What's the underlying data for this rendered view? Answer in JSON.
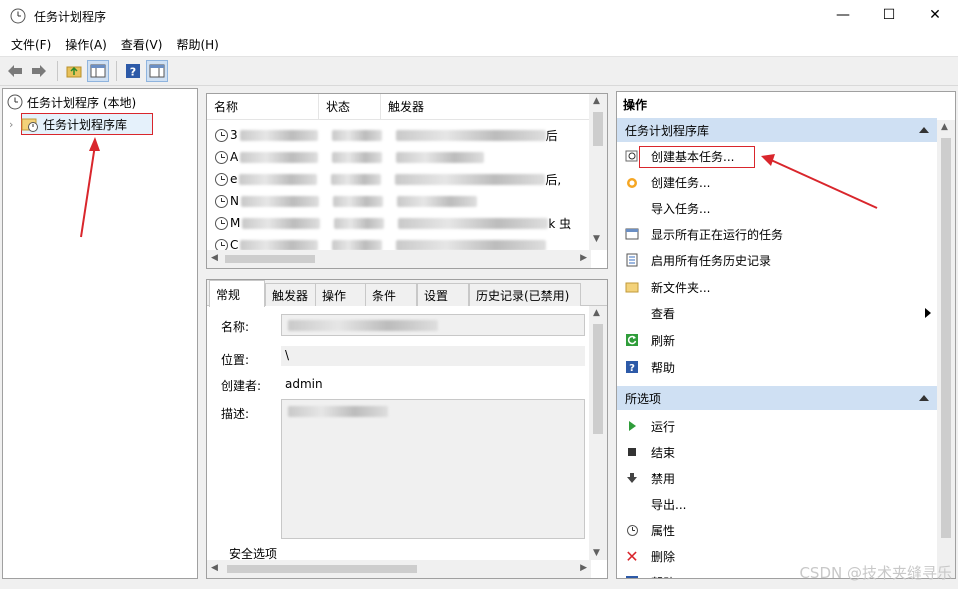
{
  "window": {
    "title": "任务计划程序",
    "min": "—",
    "max": "☐",
    "close": "✕"
  },
  "menu": [
    "文件(F)",
    "操作(A)",
    "查看(V)",
    "帮助(H)"
  ],
  "tree": {
    "root": "任务计划程序 (本地)",
    "library": "任务计划程序库"
  },
  "task_list": {
    "columns": [
      "名称",
      "状态",
      "触发器"
    ],
    "row_prefixes": [
      "3",
      "A",
      "e",
      "N",
      "M",
      "C"
    ],
    "row_suffixes": [
      "后",
      "",
      "后,",
      "",
      "k 虫",
      ""
    ]
  },
  "tabs": [
    "常规",
    "触发器",
    "操作",
    "条件",
    "设置",
    "历史记录(已禁用)"
  ],
  "general": {
    "name_label": "名称:",
    "location_label": "位置:",
    "location_value": "\\",
    "author_label": "创建者:",
    "author_value": "admin",
    "desc_label": "描述:",
    "security_label": "安全选项"
  },
  "actions": {
    "title": "操作",
    "section1": "任务计划程序库",
    "items1": [
      "创建基本任务...",
      "创建任务...",
      "导入任务...",
      "显示所有正在运行的任务",
      "启用所有任务历史记录",
      "新文件夹...",
      "查看",
      "刷新",
      "帮助"
    ],
    "section2": "所选项",
    "items2": [
      "运行",
      "结束",
      "禁用",
      "导出...",
      "属性",
      "删除",
      "帮助"
    ]
  },
  "watermark": "CSDN @技术夹缝寻乐",
  "colors": {
    "section_bg": "#cfe0f3",
    "annotation": "#d9262c"
  }
}
